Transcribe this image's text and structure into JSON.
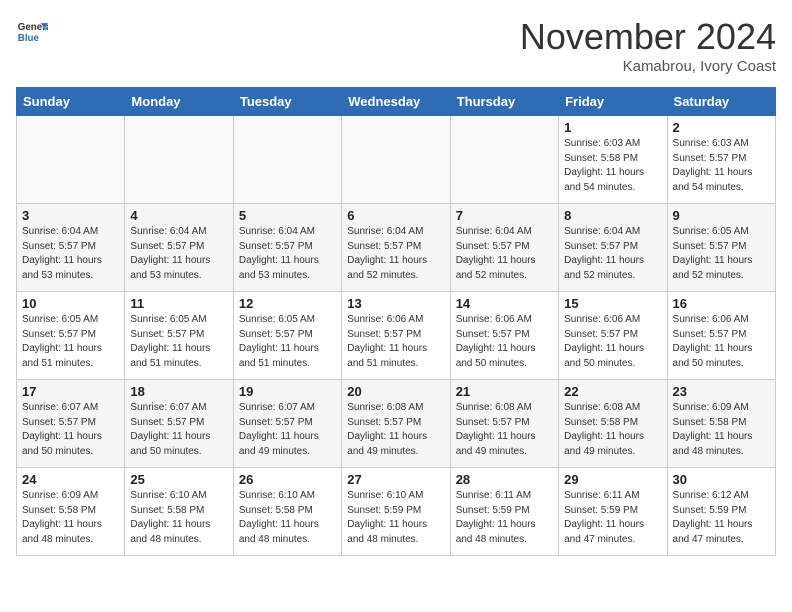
{
  "header": {
    "logo_line1": "General",
    "logo_line2": "Blue",
    "month": "November 2024",
    "location": "Kamabrou, Ivory Coast"
  },
  "weekdays": [
    "Sunday",
    "Monday",
    "Tuesday",
    "Wednesday",
    "Thursday",
    "Friday",
    "Saturday"
  ],
  "weeks": [
    [
      {
        "day": "",
        "info": ""
      },
      {
        "day": "",
        "info": ""
      },
      {
        "day": "",
        "info": ""
      },
      {
        "day": "",
        "info": ""
      },
      {
        "day": "",
        "info": ""
      },
      {
        "day": "1",
        "info": "Sunrise: 6:03 AM\nSunset: 5:58 PM\nDaylight: 11 hours\nand 54 minutes."
      },
      {
        "day": "2",
        "info": "Sunrise: 6:03 AM\nSunset: 5:57 PM\nDaylight: 11 hours\nand 54 minutes."
      }
    ],
    [
      {
        "day": "3",
        "info": "Sunrise: 6:04 AM\nSunset: 5:57 PM\nDaylight: 11 hours\nand 53 minutes."
      },
      {
        "day": "4",
        "info": "Sunrise: 6:04 AM\nSunset: 5:57 PM\nDaylight: 11 hours\nand 53 minutes."
      },
      {
        "day": "5",
        "info": "Sunrise: 6:04 AM\nSunset: 5:57 PM\nDaylight: 11 hours\nand 53 minutes."
      },
      {
        "day": "6",
        "info": "Sunrise: 6:04 AM\nSunset: 5:57 PM\nDaylight: 11 hours\nand 52 minutes."
      },
      {
        "day": "7",
        "info": "Sunrise: 6:04 AM\nSunset: 5:57 PM\nDaylight: 11 hours\nand 52 minutes."
      },
      {
        "day": "8",
        "info": "Sunrise: 6:04 AM\nSunset: 5:57 PM\nDaylight: 11 hours\nand 52 minutes."
      },
      {
        "day": "9",
        "info": "Sunrise: 6:05 AM\nSunset: 5:57 PM\nDaylight: 11 hours\nand 52 minutes."
      }
    ],
    [
      {
        "day": "10",
        "info": "Sunrise: 6:05 AM\nSunset: 5:57 PM\nDaylight: 11 hours\nand 51 minutes."
      },
      {
        "day": "11",
        "info": "Sunrise: 6:05 AM\nSunset: 5:57 PM\nDaylight: 11 hours\nand 51 minutes."
      },
      {
        "day": "12",
        "info": "Sunrise: 6:05 AM\nSunset: 5:57 PM\nDaylight: 11 hours\nand 51 minutes."
      },
      {
        "day": "13",
        "info": "Sunrise: 6:06 AM\nSunset: 5:57 PM\nDaylight: 11 hours\nand 51 minutes."
      },
      {
        "day": "14",
        "info": "Sunrise: 6:06 AM\nSunset: 5:57 PM\nDaylight: 11 hours\nand 50 minutes."
      },
      {
        "day": "15",
        "info": "Sunrise: 6:06 AM\nSunset: 5:57 PM\nDaylight: 11 hours\nand 50 minutes."
      },
      {
        "day": "16",
        "info": "Sunrise: 6:06 AM\nSunset: 5:57 PM\nDaylight: 11 hours\nand 50 minutes."
      }
    ],
    [
      {
        "day": "17",
        "info": "Sunrise: 6:07 AM\nSunset: 5:57 PM\nDaylight: 11 hours\nand 50 minutes."
      },
      {
        "day": "18",
        "info": "Sunrise: 6:07 AM\nSunset: 5:57 PM\nDaylight: 11 hours\nand 50 minutes."
      },
      {
        "day": "19",
        "info": "Sunrise: 6:07 AM\nSunset: 5:57 PM\nDaylight: 11 hours\nand 49 minutes."
      },
      {
        "day": "20",
        "info": "Sunrise: 6:08 AM\nSunset: 5:57 PM\nDaylight: 11 hours\nand 49 minutes."
      },
      {
        "day": "21",
        "info": "Sunrise: 6:08 AM\nSunset: 5:57 PM\nDaylight: 11 hours\nand 49 minutes."
      },
      {
        "day": "22",
        "info": "Sunrise: 6:08 AM\nSunset: 5:58 PM\nDaylight: 11 hours\nand 49 minutes."
      },
      {
        "day": "23",
        "info": "Sunrise: 6:09 AM\nSunset: 5:58 PM\nDaylight: 11 hours\nand 48 minutes."
      }
    ],
    [
      {
        "day": "24",
        "info": "Sunrise: 6:09 AM\nSunset: 5:58 PM\nDaylight: 11 hours\nand 48 minutes."
      },
      {
        "day": "25",
        "info": "Sunrise: 6:10 AM\nSunset: 5:58 PM\nDaylight: 11 hours\nand 48 minutes."
      },
      {
        "day": "26",
        "info": "Sunrise: 6:10 AM\nSunset: 5:58 PM\nDaylight: 11 hours\nand 48 minutes."
      },
      {
        "day": "27",
        "info": "Sunrise: 6:10 AM\nSunset: 5:59 PM\nDaylight: 11 hours\nand 48 minutes."
      },
      {
        "day": "28",
        "info": "Sunrise: 6:11 AM\nSunset: 5:59 PM\nDaylight: 11 hours\nand 48 minutes."
      },
      {
        "day": "29",
        "info": "Sunrise: 6:11 AM\nSunset: 5:59 PM\nDaylight: 11 hours\nand 47 minutes."
      },
      {
        "day": "30",
        "info": "Sunrise: 6:12 AM\nSunset: 5:59 PM\nDaylight: 11 hours\nand 47 minutes."
      }
    ]
  ]
}
